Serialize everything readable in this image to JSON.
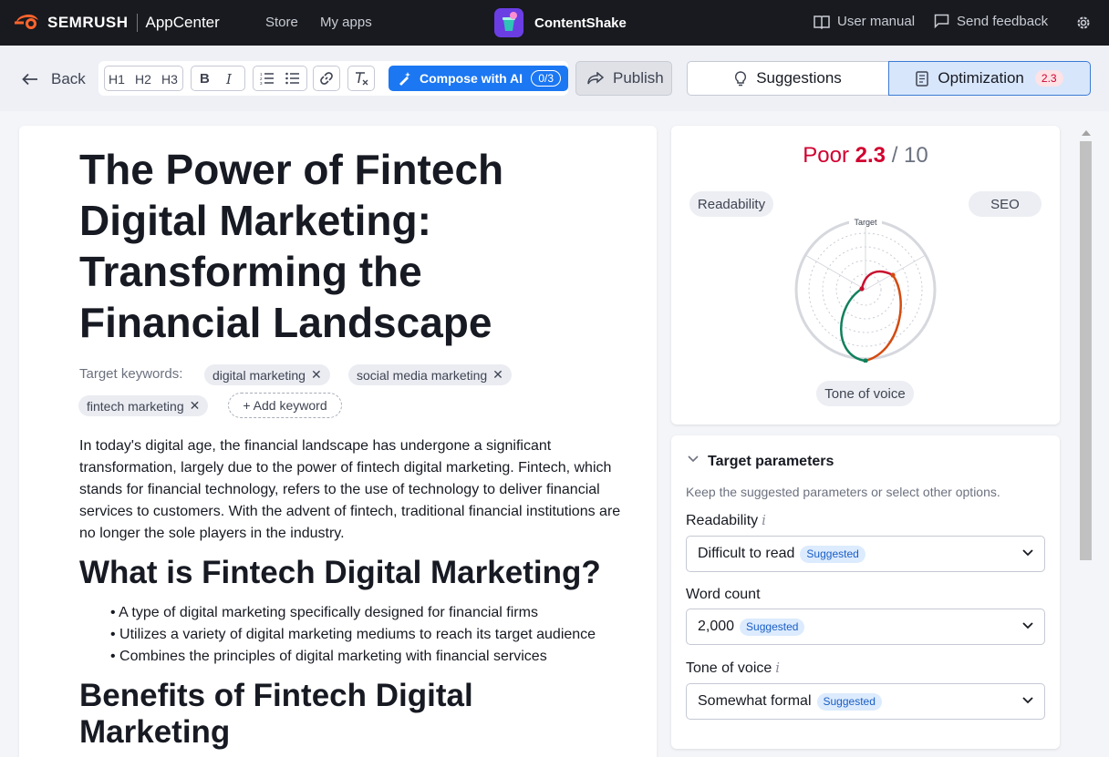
{
  "topbar": {
    "brand": "SEMRUSH",
    "product": "AppCenter",
    "nav": [
      "Store",
      "My apps"
    ],
    "app_name": "ContentShake",
    "user_manual": "User manual",
    "send_feedback": "Send feedback"
  },
  "toolbar": {
    "back": "Back",
    "h1": "H1",
    "h2": "H2",
    "h3": "H3",
    "bold": "B",
    "italic": "I",
    "compose": "Compose with AI",
    "compose_count": "0/3",
    "publish": "Publish",
    "suggestions_tab": "Suggestions",
    "optimization_tab": "Optimization",
    "optimization_badge": "2.3"
  },
  "editor": {
    "title": "The Power of Fintech Digital Marketing: Transforming the Financial Landscape",
    "keywords_label": "Target keywords:",
    "keywords": [
      "digital marketing",
      "social media marketing",
      "fintech marketing"
    ],
    "add_keyword": "+ Add keyword",
    "intro": "In today's digital age, the financial landscape has undergone a significant transformation, largely due to the power of fintech digital marketing. Fintech, which stands for financial technology, refers to the use of technology to deliver financial services to customers. With the advent of fintech, traditional financial institutions are no longer the sole players in the industry.",
    "h2_1": "What is Fintech Digital Marketing?",
    "bullets": [
      "A type of digital marketing specifically designed for financial firms",
      "Utilizes a variety of digital marketing mediums to reach its target audience",
      "Combines the principles of digital marketing with financial services"
    ],
    "h2_2": "Benefits of Fintech Digital Marketing"
  },
  "score": {
    "rating": "Poor",
    "value": "2.3",
    "max": "/ 10",
    "readability": "Readability",
    "seo": "SEO",
    "tone": "Tone of voice",
    "target_label": "Target"
  },
  "params": {
    "title": "Target parameters",
    "desc": "Keep the suggested parameters or select other options.",
    "readability_label": "Readability",
    "readability_value": "Difficult to read",
    "wordcount_label": "Word count",
    "wordcount_value": "2,000",
    "tone_label": "Tone of voice",
    "tone_value": "Somewhat formal",
    "suggested": "Suggested",
    "info": "i"
  },
  "colors": {
    "accent": "#1b77f2",
    "poor": "#d1002f",
    "topbar": "#181a1f",
    "brand_orange": "#ff642d",
    "app_purple": "#6b3ee4"
  }
}
